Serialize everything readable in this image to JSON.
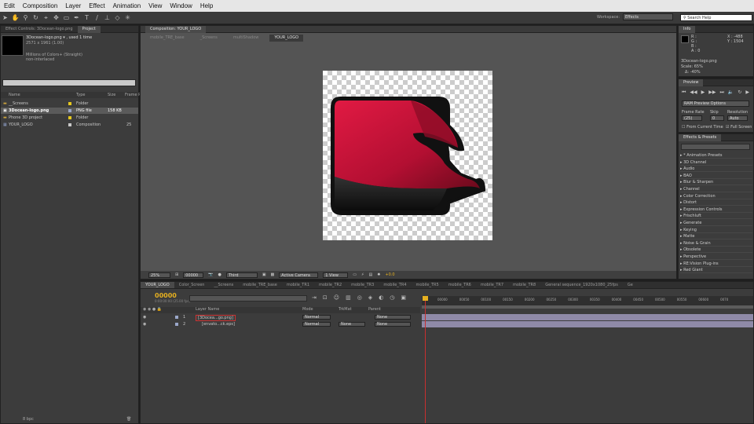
{
  "menu": [
    "Edit",
    "Composition",
    "Layer",
    "Effect",
    "Animation",
    "View",
    "Window",
    "Help"
  ],
  "toolbar": {
    "workspace_label": "Workspace:",
    "workspace_value": "Effects",
    "search_placeholder": "Search Help"
  },
  "project": {
    "tabs": [
      "Effect Controls: 3Docean-logo.png",
      "Project"
    ],
    "thumb_name": "3Docean-logo.png ▾ , used 1 time",
    "thumb_dims": "2571 x 1961 (1.00)",
    "thumb_color": "Millions of Colors+ (Straight)",
    "thumb_interlace": "non-interlaced",
    "headers": [
      "Name",
      "Type",
      "Size",
      "Frame R"
    ],
    "items": [
      {
        "name": "__Screens",
        "type": "Folder",
        "size": "",
        "frame": ""
      },
      {
        "name": "3Docean-logo.png",
        "type": "PNG file",
        "size": "158 KB",
        "frame": ""
      },
      {
        "name": "Phone 3D project",
        "type": "Folder",
        "size": "",
        "frame": ""
      },
      {
        "name": "YOUR_LOGO",
        "type": "Composition",
        "size": "",
        "frame": "25"
      }
    ],
    "bpc": "8 bpc"
  },
  "composition": {
    "tab": "Composition: YOUR_LOGO",
    "flow": [
      "mobile_TRE_base",
      "_Screens",
      "multiShadow",
      "YOUR_LOGO"
    ],
    "zoom": "25%",
    "timecode": "00000",
    "resolution": "Third",
    "camera": "Active Camera",
    "view": "1 View",
    "offset": "+0.0"
  },
  "info": {
    "tab": "Info",
    "r": "R :",
    "g": "G :",
    "b": "B :",
    "a": "A : 0",
    "x": "X : -488",
    "y": "Y : 1504",
    "file": "3Docean-logo.png",
    "scale": "Scale: 65%",
    "delta": "Δ: -40%"
  },
  "preview": {
    "tab": "Preview",
    "ram_options": "RAM Preview Options",
    "frame_rate_label": "Frame Rate",
    "skip_label": "Skip",
    "res_label": "Resolution",
    "frame_rate": "(25)",
    "skip": "0",
    "res": "Auto",
    "from_current": "From Current Time",
    "full_screen": "Full Screen"
  },
  "effects": {
    "tab": "Effects & Presets",
    "items": [
      "* Animation Presets",
      "3D Channel",
      "Audio",
      "BAO",
      "Blur & Sharpen",
      "Channel",
      "Color Correction",
      "Distort",
      "Expression Controls",
      "Frischluft",
      "Generate",
      "Keying",
      "Matte",
      "Noise & Grain",
      "Obsolete",
      "Perspective",
      "RE:Vision Plug-ins",
      "Red Giant"
    ]
  },
  "timeline": {
    "tabs": [
      "YOUR_LOGO",
      "Color_Screen",
      "__Screens",
      "mobile_TRE_base",
      "mobile_TR1",
      "mobile_TR2",
      "mobile_TR3",
      "mobile_TR4",
      "mobile_TR5",
      "mobile_TR6",
      "mobile_TR7",
      "mobile_TR8",
      "General sequence_1920x1080_25fps",
      "Ge"
    ],
    "timecode": "00000",
    "timecode_sub": "0:00:00:00 (25.00 fps)",
    "headers": {
      "layer_name": "Layer Name",
      "mode": "Mode",
      "trkmat": "TrkMat",
      "parent": "Parent"
    },
    "layers": [
      {
        "num": "1",
        "name": "[3Docea...go.png]",
        "mode": "Normal",
        "trk": "",
        "parent": "None"
      },
      {
        "num": "2",
        "name": "[envato...ck.eps]",
        "mode": "Normal",
        "trk": "None",
        "parent": "None"
      }
    ],
    "ruler": [
      "00000",
      "00050",
      "00100",
      "00150",
      "00200",
      "00250",
      "00300",
      "00350",
      "00400",
      "00450",
      "00500",
      "00550",
      "00600",
      "0070"
    ]
  },
  "colors": {
    "logo_red": "#c8143a",
    "logo_dark": "#111111",
    "accent": "#f0c020"
  }
}
